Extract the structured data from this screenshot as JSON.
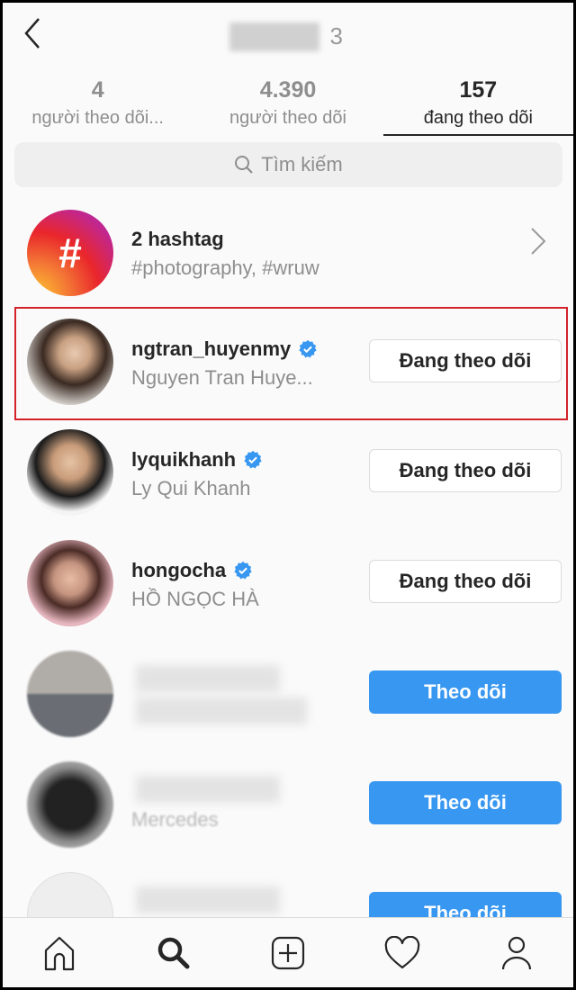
{
  "header": {
    "title_visible_suffix": "3",
    "back_icon": "chevron-left-icon"
  },
  "tabs": [
    {
      "count": "4",
      "label": "người theo dõi...",
      "active": false
    },
    {
      "count": "4.390",
      "label": "người theo dõi",
      "active": false
    },
    {
      "count": "157",
      "label": "đang theo dõi",
      "active": true
    }
  ],
  "search": {
    "placeholder": "Tìm kiếm",
    "icon": "search-icon"
  },
  "hashtags": {
    "title": "2 hashtag",
    "subtitle": "#photography, #wruw",
    "icon": "hashtag-icon"
  },
  "accounts": [
    {
      "username": "ngtran_huyenmy",
      "full_name": "Nguyen Tran Huye...",
      "verified": true,
      "button": "Đang theo dõi",
      "state": "following",
      "highlighted": true
    },
    {
      "username": "lyquikhanh",
      "full_name": "Ly Qui Khanh",
      "verified": true,
      "button": "Đang theo dõi",
      "state": "following"
    },
    {
      "username": "hongocha",
      "full_name": "HỒ NGỌC HÀ",
      "verified": true,
      "button": "Đang theo dõi",
      "state": "following"
    },
    {
      "username": "",
      "full_name": "",
      "verified": false,
      "button": "Theo dõi",
      "state": "follow",
      "blurred": true
    },
    {
      "username": "",
      "full_name": "Mercedes",
      "verified": true,
      "button": "Theo dõi",
      "state": "follow",
      "blurred": true
    },
    {
      "username": "",
      "full_name": "",
      "verified": true,
      "button": "Theo dõi",
      "state": "follow",
      "blurred": true
    }
  ],
  "colors": {
    "follow_blue": "#3897f0",
    "verified_blue": "#3897f0",
    "highlight_red": "#d3222a",
    "text_primary": "#262626",
    "text_secondary": "#8e8e8e"
  },
  "bottom_nav": [
    {
      "name": "home",
      "icon": "home-icon"
    },
    {
      "name": "search",
      "icon": "search-icon",
      "active": true
    },
    {
      "name": "new-post",
      "icon": "plus-square-icon"
    },
    {
      "name": "activity",
      "icon": "heart-icon"
    },
    {
      "name": "profile",
      "icon": "person-icon"
    }
  ]
}
